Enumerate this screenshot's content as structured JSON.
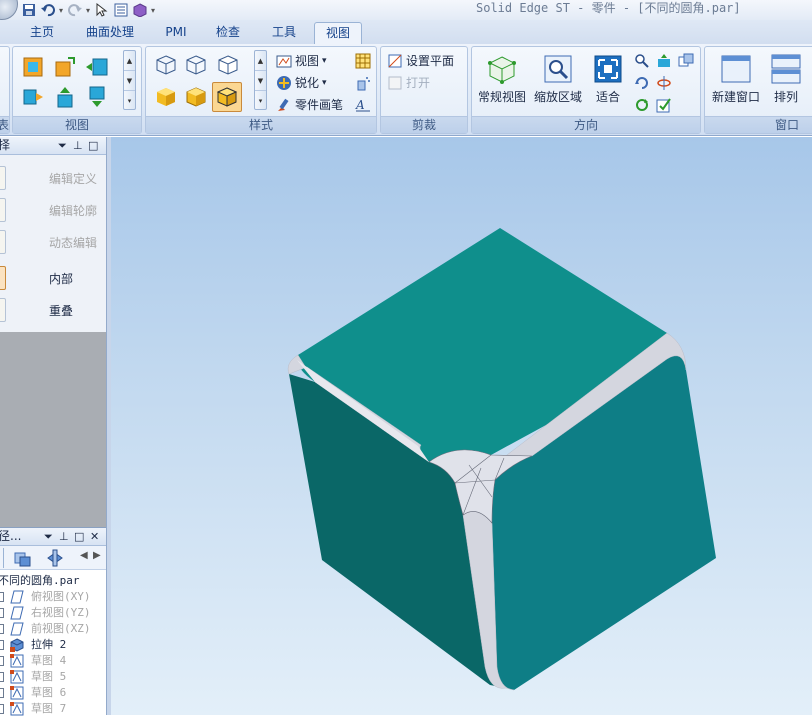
{
  "window": {
    "title": "Solid Edge ST - 零件 - [不同的圆角.par]"
  },
  "quick_access": {
    "items": [
      "save-icon",
      "undo-icon",
      "redo-icon",
      "select-icon",
      "properties-icon",
      "part-icon"
    ],
    "more": "▾"
  },
  "tabs": [
    {
      "label": "主页",
      "active": false
    },
    {
      "label": "曲面处理",
      "active": false
    },
    {
      "label": "PMI",
      "active": false
    },
    {
      "label": "检查",
      "active": false
    },
    {
      "label": "工具",
      "active": false
    },
    {
      "label": "视图",
      "active": true
    }
  ],
  "ribbon": {
    "group_partial": {
      "label": "表"
    },
    "view_group": {
      "label": "视图"
    },
    "style_group": {
      "label": "样式",
      "view_menu": "视图",
      "sharpen_menu": "锐化",
      "part_painter": "零件画笔"
    },
    "clip_group": {
      "label": "剪裁",
      "set_plane": "设置平面",
      "open": "打开"
    },
    "orient_group": {
      "label": "方向",
      "common_views": "常规视图",
      "zoom_area": "缩放区域",
      "fit": "适合"
    },
    "window_group": {
      "label": "窗口",
      "new_window": "新建窗口",
      "arrange": "排列"
    }
  },
  "select_pane": {
    "title": "择",
    "commands": [
      {
        "label": "编辑定义",
        "enabled": false
      },
      {
        "label": "编辑轮廓",
        "enabled": false
      },
      {
        "label": "动态编辑",
        "enabled": false
      },
      {
        "label": "内部",
        "enabled": true
      },
      {
        "label": "重叠",
        "enabled": true
      }
    ]
  },
  "pathfinder": {
    "title": "径...",
    "root": "不同的圆角.par",
    "items": [
      {
        "label": "俯视图(XY)",
        "dim": true
      },
      {
        "label": "右视图(YZ)",
        "dim": true
      },
      {
        "label": "前视图(XZ)",
        "dim": true
      },
      {
        "label": "拉伸 2",
        "dim": false
      },
      {
        "label": "草图 4",
        "dim": true
      },
      {
        "label": "草图 5",
        "dim": true
      },
      {
        "label": "草图 6",
        "dim": true
      },
      {
        "label": "草图 7",
        "dim": true
      }
    ]
  },
  "colors": {
    "accent": "#15428b",
    "model_face_top": "#0f8f8c",
    "model_face_left": "#0a6767",
    "model_face_right": "#0e7e86",
    "fillet": "#d4d6df",
    "viewport_top": "#a7c7e9",
    "viewport_bottom": "#e3eff9"
  }
}
